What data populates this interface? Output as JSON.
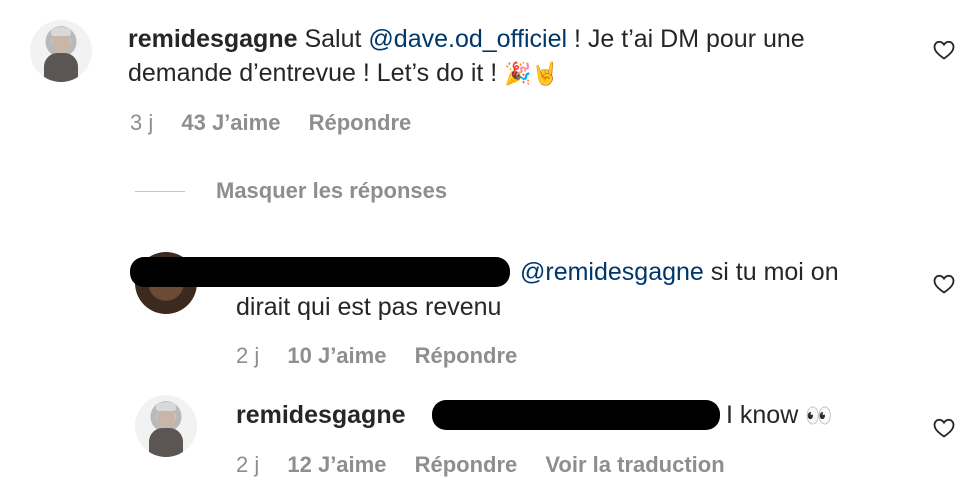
{
  "comment": {
    "username": "remidesgagne",
    "text_start": "Salut ",
    "mention": "@dave.od_officiel",
    "text_end": " ! Je t’ai DM pour une",
    "text_line2": "demande d’entrevue ! Let’s do it ! ",
    "emojis": "🎉🤘",
    "time": "3 j",
    "likes": "43 J’aime",
    "reply_label": "Répondre"
  },
  "hide_replies": "Masquer les réponses",
  "reply1": {
    "mention": "@remidesgagne",
    "text_end": " si tu moi on",
    "text_line2": "dirait qui est pas revenu",
    "time": "2 j",
    "likes": "10 J’aime",
    "reply_label": "Répondre"
  },
  "reply2": {
    "username": "remidesgagne",
    "text": "I know ",
    "emoji": "👀",
    "time": "2 j",
    "likes": "12 J’aime",
    "reply_label": "Répondre",
    "translate_label": "Voir la traduction"
  },
  "icons": {
    "like": "heart-outline-icon"
  }
}
